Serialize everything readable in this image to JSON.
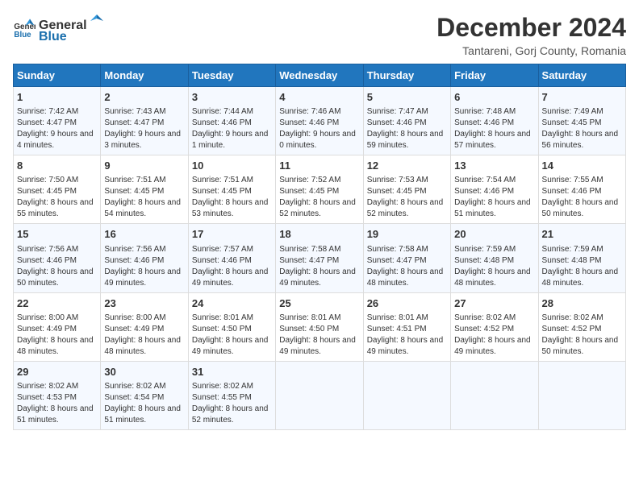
{
  "logo": {
    "text_general": "General",
    "text_blue": "Blue"
  },
  "title": "December 2024",
  "subtitle": "Tantareni, Gorj County, Romania",
  "headers": [
    "Sunday",
    "Monday",
    "Tuesday",
    "Wednesday",
    "Thursday",
    "Friday",
    "Saturday"
  ],
  "weeks": [
    [
      {
        "day": "1",
        "sunrise": "7:42 AM",
        "sunset": "4:47 PM",
        "daylight": "9 hours and 4 minutes."
      },
      {
        "day": "2",
        "sunrise": "7:43 AM",
        "sunset": "4:47 PM",
        "daylight": "9 hours and 3 minutes."
      },
      {
        "day": "3",
        "sunrise": "7:44 AM",
        "sunset": "4:46 PM",
        "daylight": "9 hours and 1 minute."
      },
      {
        "day": "4",
        "sunrise": "7:46 AM",
        "sunset": "4:46 PM",
        "daylight": "9 hours and 0 minutes."
      },
      {
        "day": "5",
        "sunrise": "7:47 AM",
        "sunset": "4:46 PM",
        "daylight": "8 hours and 59 minutes."
      },
      {
        "day": "6",
        "sunrise": "7:48 AM",
        "sunset": "4:46 PM",
        "daylight": "8 hours and 57 minutes."
      },
      {
        "day": "7",
        "sunrise": "7:49 AM",
        "sunset": "4:45 PM",
        "daylight": "8 hours and 56 minutes."
      }
    ],
    [
      {
        "day": "8",
        "sunrise": "7:50 AM",
        "sunset": "4:45 PM",
        "daylight": "8 hours and 55 minutes."
      },
      {
        "day": "9",
        "sunrise": "7:51 AM",
        "sunset": "4:45 PM",
        "daylight": "8 hours and 54 minutes."
      },
      {
        "day": "10",
        "sunrise": "7:51 AM",
        "sunset": "4:45 PM",
        "daylight": "8 hours and 53 minutes."
      },
      {
        "day": "11",
        "sunrise": "7:52 AM",
        "sunset": "4:45 PM",
        "daylight": "8 hours and 52 minutes."
      },
      {
        "day": "12",
        "sunrise": "7:53 AM",
        "sunset": "4:45 PM",
        "daylight": "8 hours and 52 minutes."
      },
      {
        "day": "13",
        "sunrise": "7:54 AM",
        "sunset": "4:46 PM",
        "daylight": "8 hours and 51 minutes."
      },
      {
        "day": "14",
        "sunrise": "7:55 AM",
        "sunset": "4:46 PM",
        "daylight": "8 hours and 50 minutes."
      }
    ],
    [
      {
        "day": "15",
        "sunrise": "7:56 AM",
        "sunset": "4:46 PM",
        "daylight": "8 hours and 50 minutes."
      },
      {
        "day": "16",
        "sunrise": "7:56 AM",
        "sunset": "4:46 PM",
        "daylight": "8 hours and 49 minutes."
      },
      {
        "day": "17",
        "sunrise": "7:57 AM",
        "sunset": "4:46 PM",
        "daylight": "8 hours and 49 minutes."
      },
      {
        "day": "18",
        "sunrise": "7:58 AM",
        "sunset": "4:47 PM",
        "daylight": "8 hours and 49 minutes."
      },
      {
        "day": "19",
        "sunrise": "7:58 AM",
        "sunset": "4:47 PM",
        "daylight": "8 hours and 48 minutes."
      },
      {
        "day": "20",
        "sunrise": "7:59 AM",
        "sunset": "4:48 PM",
        "daylight": "8 hours and 48 minutes."
      },
      {
        "day": "21",
        "sunrise": "7:59 AM",
        "sunset": "4:48 PM",
        "daylight": "8 hours and 48 minutes."
      }
    ],
    [
      {
        "day": "22",
        "sunrise": "8:00 AM",
        "sunset": "4:49 PM",
        "daylight": "8 hours and 48 minutes."
      },
      {
        "day": "23",
        "sunrise": "8:00 AM",
        "sunset": "4:49 PM",
        "daylight": "8 hours and 48 minutes."
      },
      {
        "day": "24",
        "sunrise": "8:01 AM",
        "sunset": "4:50 PM",
        "daylight": "8 hours and 49 minutes."
      },
      {
        "day": "25",
        "sunrise": "8:01 AM",
        "sunset": "4:50 PM",
        "daylight": "8 hours and 49 minutes."
      },
      {
        "day": "26",
        "sunrise": "8:01 AM",
        "sunset": "4:51 PM",
        "daylight": "8 hours and 49 minutes."
      },
      {
        "day": "27",
        "sunrise": "8:02 AM",
        "sunset": "4:52 PM",
        "daylight": "8 hours and 49 minutes."
      },
      {
        "day": "28",
        "sunrise": "8:02 AM",
        "sunset": "4:52 PM",
        "daylight": "8 hours and 50 minutes."
      }
    ],
    [
      {
        "day": "29",
        "sunrise": "8:02 AM",
        "sunset": "4:53 PM",
        "daylight": "8 hours and 51 minutes."
      },
      {
        "day": "30",
        "sunrise": "8:02 AM",
        "sunset": "4:54 PM",
        "daylight": "8 hours and 51 minutes."
      },
      {
        "day": "31",
        "sunrise": "8:02 AM",
        "sunset": "4:55 PM",
        "daylight": "8 hours and 52 minutes."
      },
      null,
      null,
      null,
      null
    ]
  ],
  "labels": {
    "sunrise": "Sunrise:",
    "sunset": "Sunset:",
    "daylight": "Daylight:"
  }
}
